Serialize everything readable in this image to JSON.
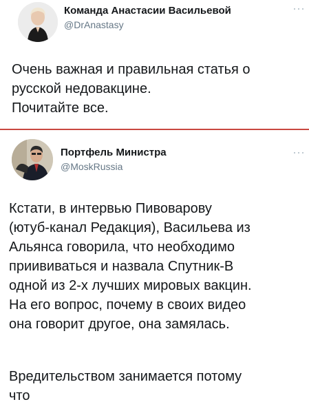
{
  "tweets": [
    {
      "author_name": "Команда Анастасии Васильевой",
      "handle": "@DrAnastasy",
      "text": "Очень важная и правильная статья о\nрусской недовакцине.\nПочитайте все."
    },
    {
      "author_name": "Портфель Министра",
      "handle": "@MoskRussia",
      "text": "Кстати, в интервью Пивоварову\n(ютуб-канал Редакция), Васильева из\nАльянса говорила, что необходимо\nприививаться и назвала Спутник-В\nодной из 2-х лучших мировых вакцин.\nНа его вопрос, почему в своих видео\nона говорит другое, она замялась.",
      "text_continued": "Вредительством занимается потому\nчто"
    }
  ],
  "colors": {
    "separator": "#c9473f",
    "handle": "#657786",
    "text": "#14171a"
  },
  "icons": {
    "more": "more-options-icon"
  }
}
